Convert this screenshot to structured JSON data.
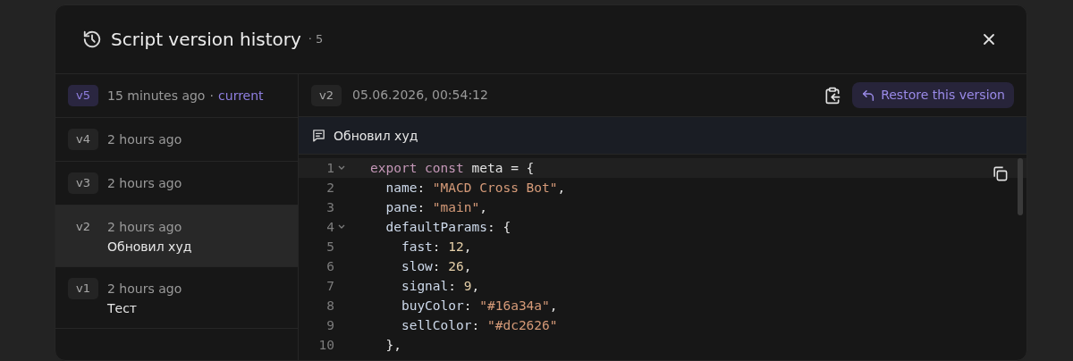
{
  "dialog": {
    "title": "Script version history",
    "count": "· 5"
  },
  "versions": [
    {
      "version": "v5",
      "time": "15 minutes ago",
      "separator": "·",
      "current_label": "current",
      "current": true,
      "selected": false
    },
    {
      "version": "v4",
      "time": "2 hours ago",
      "current": false,
      "selected": false
    },
    {
      "version": "v3",
      "time": "2 hours ago",
      "current": false,
      "selected": false
    },
    {
      "version": "v2",
      "time": "2 hours ago",
      "message": "Обновил худ",
      "current": false,
      "selected": true
    },
    {
      "version": "v1",
      "time": "2 hours ago",
      "message": "Тест",
      "current": false,
      "selected": false
    }
  ],
  "detail": {
    "version": "v2",
    "timestamp": "05.06.2026, 00:54:12",
    "restore_button": "Restore this version",
    "message": "Обновил худ"
  },
  "code_lines": [
    {
      "number": "1",
      "foldable": true,
      "active": true,
      "tokens": [
        {
          "kind": "keyword",
          "text": "export"
        },
        {
          "kind": "keyword",
          "text": " const"
        },
        {
          "kind": "plain",
          "text": " meta = {"
        }
      ]
    },
    {
      "number": "2",
      "foldable": false,
      "active": false,
      "tokens": [
        {
          "kind": "property",
          "text": "  name"
        },
        {
          "kind": "plain",
          "text": ": "
        },
        {
          "kind": "string",
          "text": "\"MACD Cross Bot\""
        },
        {
          "kind": "plain",
          "text": ","
        }
      ]
    },
    {
      "number": "3",
      "foldable": false,
      "active": false,
      "tokens": [
        {
          "kind": "property",
          "text": "  pane"
        },
        {
          "kind": "plain",
          "text": ": "
        },
        {
          "kind": "string",
          "text": "\"main\""
        },
        {
          "kind": "plain",
          "text": ","
        }
      ]
    },
    {
      "number": "4",
      "foldable": true,
      "active": false,
      "tokens": [
        {
          "kind": "property",
          "text": "  defaultParams"
        },
        {
          "kind": "plain",
          "text": ": {"
        }
      ]
    },
    {
      "number": "5",
      "foldable": false,
      "active": false,
      "tokens": [
        {
          "kind": "property",
          "text": "    fast"
        },
        {
          "kind": "plain",
          "text": ": "
        },
        {
          "kind": "number",
          "text": "12"
        },
        {
          "kind": "plain",
          "text": ","
        }
      ]
    },
    {
      "number": "6",
      "foldable": false,
      "active": false,
      "tokens": [
        {
          "kind": "property",
          "text": "    slow"
        },
        {
          "kind": "plain",
          "text": ": "
        },
        {
          "kind": "number",
          "text": "26"
        },
        {
          "kind": "plain",
          "text": ","
        }
      ]
    },
    {
      "number": "7",
      "foldable": false,
      "active": false,
      "tokens": [
        {
          "kind": "property",
          "text": "    signal"
        },
        {
          "kind": "plain",
          "text": ": "
        },
        {
          "kind": "number",
          "text": "9"
        },
        {
          "kind": "plain",
          "text": ","
        }
      ]
    },
    {
      "number": "8",
      "foldable": false,
      "active": false,
      "tokens": [
        {
          "kind": "property",
          "text": "    buyColor"
        },
        {
          "kind": "plain",
          "text": ": "
        },
        {
          "kind": "string",
          "text": "\"#16a34a\""
        },
        {
          "kind": "plain",
          "text": ","
        }
      ]
    },
    {
      "number": "9",
      "foldable": false,
      "active": false,
      "tokens": [
        {
          "kind": "property",
          "text": "    sellColor"
        },
        {
          "kind": "plain",
          "text": ": "
        },
        {
          "kind": "string",
          "text": "\"#dc2626\""
        }
      ]
    },
    {
      "number": "10",
      "foldable": false,
      "active": false,
      "tokens": [
        {
          "kind": "plain",
          "text": "  },"
        }
      ]
    }
  ]
}
